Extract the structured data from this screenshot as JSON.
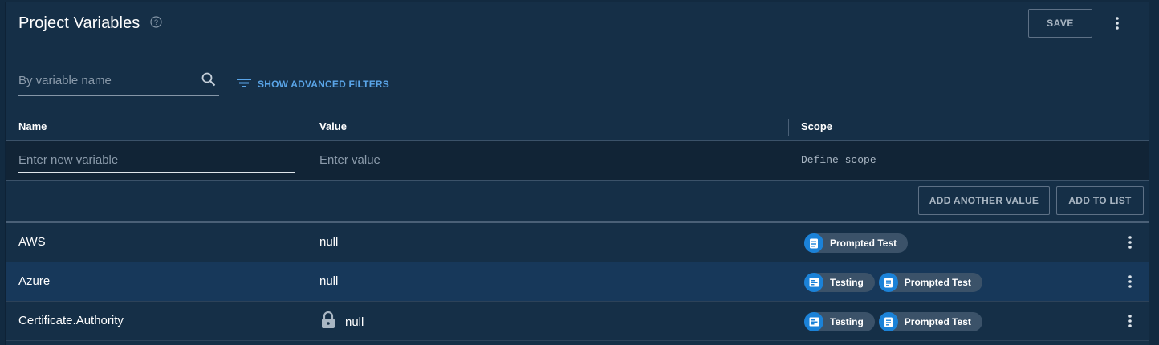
{
  "header": {
    "title": "Project Variables",
    "save_label": "SAVE"
  },
  "filters": {
    "search_placeholder": "By variable name",
    "advanced_label": "SHOW ADVANCED FILTERS"
  },
  "table": {
    "columns": [
      "Name",
      "Value",
      "Scope"
    ],
    "new_row": {
      "name_placeholder": "Enter new variable",
      "value_placeholder": "Enter value",
      "scope_placeholder": "Define scope"
    },
    "actions": {
      "add_another_value": "ADD ANOTHER VALUE",
      "add_to_list": "ADD TO LIST"
    },
    "rows": [
      {
        "name": "AWS",
        "value": "null",
        "locked": false,
        "scopes": [
          {
            "type": "process",
            "label": "Prompted Test"
          }
        ]
      },
      {
        "name": "Azure",
        "value": "null",
        "locked": false,
        "scopes": [
          {
            "type": "environment",
            "label": "Testing"
          },
          {
            "type": "process",
            "label": "Prompted Test"
          }
        ]
      },
      {
        "name": "Certificate.Authority",
        "value": "null",
        "locked": true,
        "scopes": [
          {
            "type": "environment",
            "label": "Testing"
          },
          {
            "type": "process",
            "label": "Prompted Test"
          }
        ]
      }
    ]
  },
  "colors": {
    "background": "#152f47",
    "accent_link": "#5aa5e8",
    "chip_icon": "#1b82d8",
    "chip_bg": "#3b5269",
    "highlight_row": "#17385a"
  },
  "icons": {
    "help": "help-circle-icon",
    "search": "search-icon",
    "filter": "filter-icon",
    "more": "more-vertical-icon",
    "lock": "lock-icon",
    "environment": "environment-icon",
    "process": "process-icon"
  }
}
